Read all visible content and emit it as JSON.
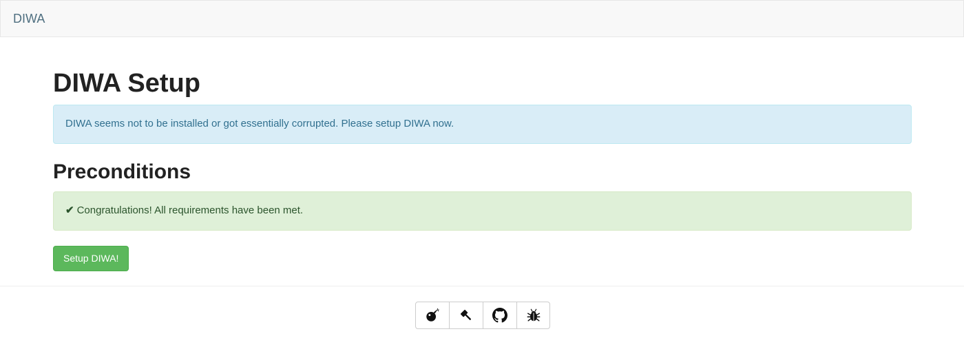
{
  "navbar": {
    "brand": "DIWA"
  },
  "main": {
    "title": "DIWA Setup",
    "info_alert": "DIWA seems not to be installed or got essentially corrupted. Please setup DIWA now.",
    "preconditions_heading": "Preconditions",
    "success_alert": "Congratulations! All requirements have been met.",
    "setup_button": "Setup DIWA!"
  },
  "footer": {
    "icons": [
      "bomb-icon",
      "gavel-icon",
      "github-icon",
      "bug-icon"
    ]
  },
  "colors": {
    "info_bg": "#d9edf7",
    "success_bg": "#dff0d8",
    "button_green": "#5cb85c"
  }
}
